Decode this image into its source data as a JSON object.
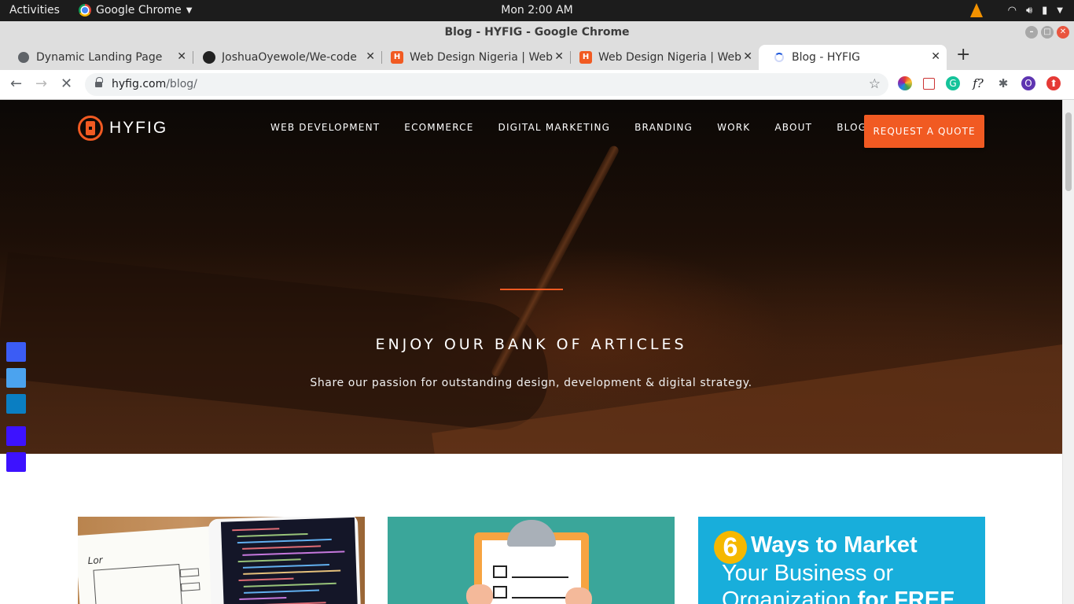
{
  "os": {
    "activities": "Activities",
    "app_name": "Google Chrome",
    "clock": "Mon  2:00 AM"
  },
  "window": {
    "title": "Blog - HYFIG - Google Chrome"
  },
  "tabs": [
    {
      "label": "Dynamic Landing Page",
      "icon": "globe-icon"
    },
    {
      "label": "JoshuaOyewole/We-code",
      "icon": "github-icon"
    },
    {
      "label": "Web Design Nigeria | Web",
      "icon": "hyfig-favicon-icon"
    },
    {
      "label": "Web Design Nigeria | Web",
      "icon": "hyfig-favicon-icon"
    },
    {
      "label": "Blog - HYFIG",
      "icon": "loading-spinner-icon",
      "active": true
    }
  ],
  "address": {
    "domain": "hyfig.com",
    "path": "/blog/"
  },
  "site": {
    "logo_text": "HYFIG",
    "nav": [
      "WEB DEVELOPMENT",
      "ECOMMERCE",
      "DIGITAL MARKETING",
      "BRANDING",
      "WORK",
      "ABOUT",
      "BLOG"
    ],
    "cta": "REQUEST A QUOTE",
    "hero_title": "ENJOY OUR BANK OF ARTICLES",
    "hero_subtitle": "Share our passion for outstanding design, development & digital strategy.",
    "share_colors": [
      "#3b5cf5",
      "#4ba3ef",
      "#0a7ec2",
      "#3d12ff",
      "#3d12ff"
    ],
    "accent": "#f15a22"
  },
  "cards": {
    "card3": {
      "number": "6",
      "line1": "Ways to Market",
      "line2": "Your Business or",
      "line3_a": "Organization",
      "line3_b": "for FREE"
    },
    "card1_sketch_text": "Lor"
  }
}
